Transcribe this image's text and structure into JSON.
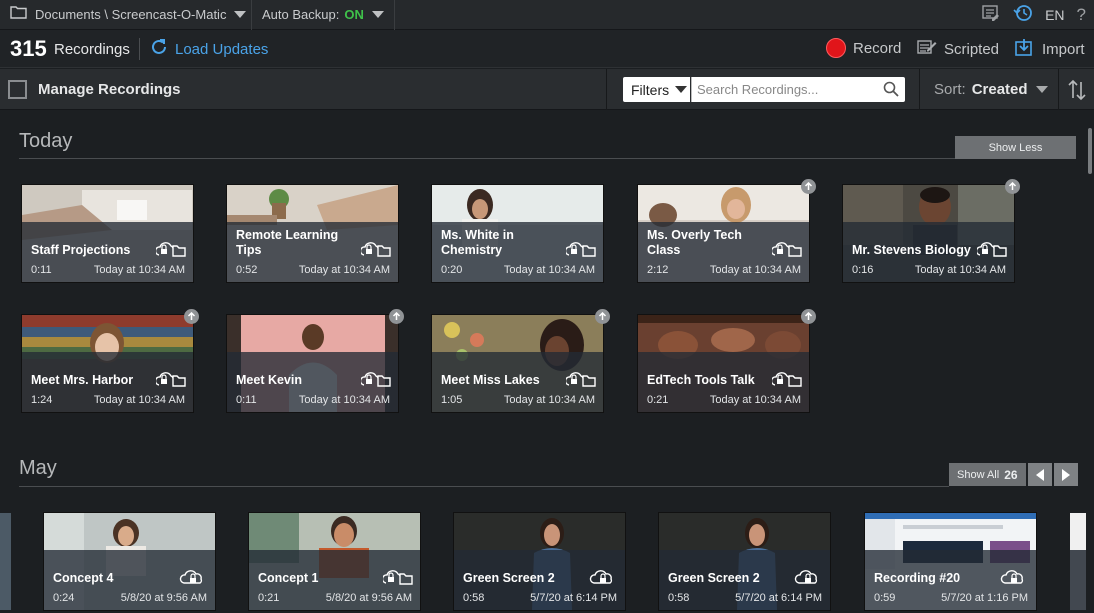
{
  "topbar": {
    "path": "Documents \\ Screencast-O-Matic",
    "auto_backup_label": "Auto Backup:",
    "auto_backup_value": "ON",
    "lang": "EN",
    "help": "?"
  },
  "toolbar": {
    "count": "315",
    "count_label": "Recordings",
    "load_updates": "Load Updates",
    "record": "Record",
    "scripted": "Scripted",
    "import": "Import"
  },
  "filterbar": {
    "manage": "Manage Recordings",
    "filters": "Filters",
    "search_placeholder": "Search Recordings...",
    "sort_label": "Sort:",
    "sort_value": "Created"
  },
  "sections": {
    "today": {
      "title": "Today",
      "show_less": "Show Less",
      "cards": [
        {
          "title": "Staff Projections",
          "duration": "0:11",
          "date": "Today at 10:34 AM"
        },
        {
          "title": "Remote Learning Tips",
          "duration": "0:52",
          "date": "Today at 10:34 AM"
        },
        {
          "title": "Ms. White in Chemistry",
          "duration": "0:20",
          "date": "Today at 10:34 AM"
        },
        {
          "title": "Ms. Overly Tech Class",
          "duration": "2:12",
          "date": "Today at 10:34 AM"
        },
        {
          "title": "Mr. Stevens Biology",
          "duration": "0:16",
          "date": "Today at 10:34 AM"
        },
        {
          "title": "Meet Mrs. Harbor",
          "duration": "1:24",
          "date": "Today at 10:34 AM"
        },
        {
          "title": "Meet Kevin",
          "duration": "0:11",
          "date": "Today at 10:34 AM"
        },
        {
          "title": "Meet Miss Lakes",
          "duration": "1:05",
          "date": "Today at 10:34 AM"
        },
        {
          "title": "EdTech Tools Talk",
          "duration": "0:21",
          "date": "Today at 10:34 AM"
        }
      ]
    },
    "may": {
      "title": "May",
      "show_all": "Show All",
      "show_all_count": "26",
      "cards": [
        {
          "title": "Concept 4",
          "duration": "0:24",
          "date": "5/8/20 at 9:56 AM"
        },
        {
          "title": "Concept 1",
          "duration": "0:21",
          "date": "5/8/20 at 9:56 AM"
        },
        {
          "title": "Green Screen 2",
          "duration": "0:58",
          "date": "5/7/20 at 6:14 PM"
        },
        {
          "title": "Green Screen 2",
          "duration": "0:58",
          "date": "5/7/20 at 6:14 PM"
        },
        {
          "title": "Recording #20",
          "duration": "0:59",
          "date": "5/7/20 at 1:16 PM"
        }
      ]
    }
  },
  "colors": {
    "accent_blue": "#4aa3e8",
    "record_red": "#e1151a",
    "backup_on_green": "#3fc14a"
  }
}
